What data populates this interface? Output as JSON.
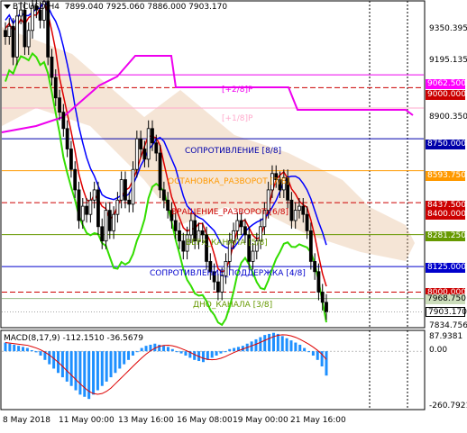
{
  "header": {
    "symbol": "BTCUSD,H4",
    "ohlc": "7899.040 7925.060 7886.000 7903.170"
  },
  "macd": {
    "label": "MACD(8,17,9) -112.1510 -36.5679",
    "axis_top": "87.9381",
    "axis_zero": "0.00",
    "axis_bottom": "-260.7921"
  },
  "price_axis": {
    "ticks": [
      "9350.395",
      "9195.135",
      "8900.350",
      "8750.000",
      "8593.750",
      "8437.500",
      "8400.000",
      "8281.250",
      "8125.000",
      "7968.750",
      "7903.170",
      "7834.756"
    ]
  },
  "price_tags": [
    {
      "label": "9062.500",
      "color": "#ff00ff"
    },
    {
      "label": "9000.000",
      "color": "#cc0000"
    },
    {
      "label": "8750.000",
      "color": "#0000aa"
    },
    {
      "label": "8593.750",
      "color": "#ff9900"
    },
    {
      "label": "8437.500",
      "color": "#cc0000"
    },
    {
      "label": "8400.000",
      "color": "#cc0000"
    },
    {
      "label": "8281.250",
      "color": "#669900"
    },
    {
      "label": "8125.000",
      "color": "#0000cc"
    },
    {
      "label": "8000.000",
      "color": "#cc0000"
    },
    {
      "label": "7968.750",
      "color": "#ccddbb"
    },
    {
      "label": "7903.170",
      "color": "#ffffff"
    }
  ],
  "levels": {
    "l_plus2": "[+2/8]P",
    "l_plus1": "[+1/8]P",
    "resistance": "СОПРОТИВЛЕНИЕ [8/8]",
    "stop_reversal": "ОСТАНОВКА_РАЗВОРОТ [7/8]",
    "rotation": "ВРАЩЕНИЕ_РАЗВОРОТ [6/8]",
    "channel_top": "ВЕРХ_КАНАЛА [5/8]",
    "support_resistance": "СОПРОТИВЛЕНИЕ_ПОДДЕРЖКА [4/8]",
    "channel_bottom": "ДНО_КАНАЛА [3/8]"
  },
  "time_axis": [
    "8 May 2018",
    "11 May 00:00",
    "13 May 16:00",
    "16 May 08:00",
    "19 May 00:00",
    "21 May 16:00"
  ],
  "colors": {
    "up_candle": "#000000",
    "ma_red": "#dd0000",
    "ma_blue": "#0000ff",
    "ma_magenta": "#ee00ee",
    "ma_green": "#33dd00",
    "ichimoku_cloud": "#e3b48a",
    "macd_hist": "#1e90ff",
    "macd_signal": "#dd0000"
  },
  "chart_data": {
    "type": "candlestick",
    "symbol": "BTCUSD",
    "timeframe": "H4",
    "ylim": [
      7834.756,
      9420
    ],
    "x_labels": [
      "8 May 2018",
      "11 May 00:00",
      "13 May 16:00",
      "16 May 08:00",
      "19 May 00:00",
      "21 May 16:00"
    ],
    "close_series": [
      9250,
      9300,
      9150,
      9350,
      9380,
      9200,
      9280,
      9400,
      9380,
      9330,
      9420,
      9150,
      9050,
      8950,
      8880,
      8800,
      8700,
      8600,
      8500,
      8350,
      8420,
      8380,
      8450,
      8500,
      8320,
      8250,
      8400,
      8300,
      8380,
      8450,
      8550,
      8450,
      8430,
      8600,
      8750,
      8700,
      8650,
      8800,
      8730,
      8680,
      8500,
      8450,
      8400,
      8350,
      8300,
      8250,
      8200,
      8280,
      8350,
      8250,
      8300,
      8280,
      8150,
      8100,
      8050,
      8000,
      8080,
      8150,
      8250,
      8300,
      8350,
      8320,
      8280,
      8150,
      8200,
      8250,
      8320,
      8400,
      8500,
      8580,
      8550,
      8500,
      8560,
      8450,
      8350,
      8400,
      8420,
      8380,
      8300,
      8150,
      8100,
      8000,
      7950,
      7903.17
    ],
    "macd_hist": [
      40,
      35,
      30,
      25,
      20,
      15,
      5,
      -5,
      -20,
      -40,
      -60,
      -80,
      -100,
      -120,
      -140,
      -160,
      -180,
      -200,
      -210,
      -220,
      -200,
      -180,
      -160,
      -140,
      -120,
      -100,
      -80,
      -60,
      -40,
      -20,
      0,
      15,
      25,
      30,
      35,
      30,
      25,
      20,
      10,
      0,
      -10,
      -20,
      -30,
      -40,
      -45,
      -50,
      -40,
      -30,
      -20,
      -10,
      0,
      10,
      15,
      20,
      25,
      35,
      45,
      55,
      65,
      75,
      80,
      85,
      80,
      70,
      60,
      50,
      40,
      30,
      15,
      0,
      -20,
      -40,
      -70,
      -112.151
    ]
  }
}
